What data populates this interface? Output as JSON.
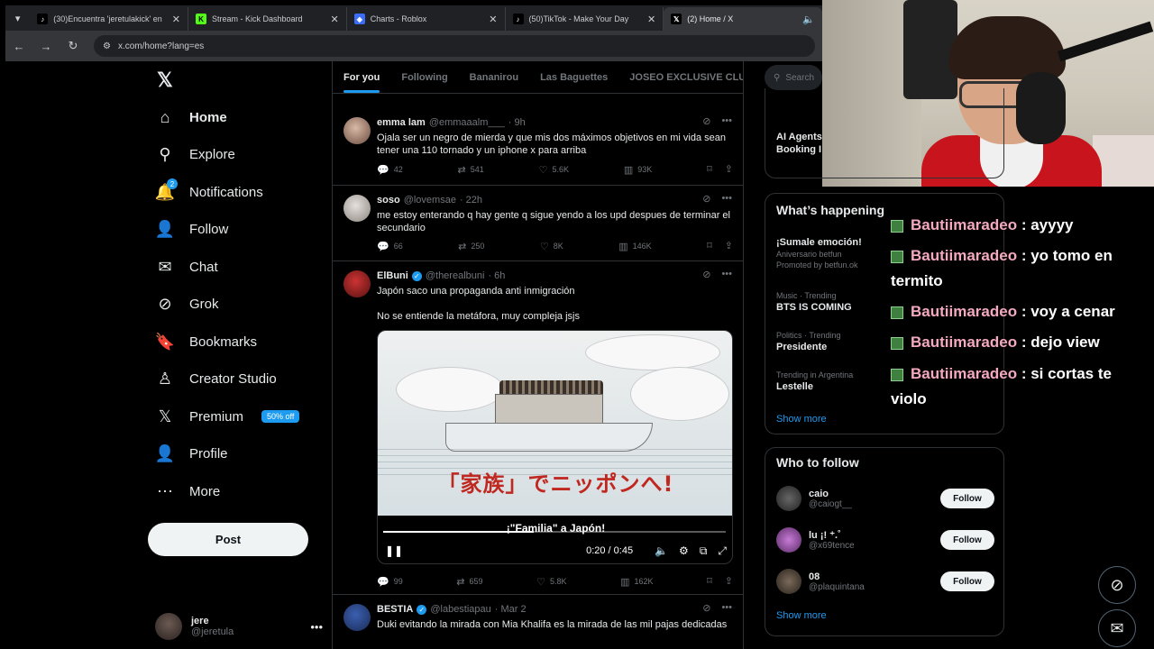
{
  "browser": {
    "tabs": [
      {
        "title": "(30)Encuentra 'jeretulakick' en",
        "color": "#000000",
        "icon": "tiktok-icon",
        "glyph": "♪"
      },
      {
        "title": "Stream - Kick Dashboard",
        "color": "#53fc18",
        "icon": "kick-icon",
        "glyph": "K"
      },
      {
        "title": "Charts - Roblox",
        "color": "#3b6cf6",
        "icon": "roblox-icon",
        "glyph": "◈"
      },
      {
        "title": "(50)TikTok - Make Your Day",
        "color": "#000000",
        "icon": "tiktok-icon",
        "glyph": "♪"
      },
      {
        "title": "(2) Home / X",
        "color": "#000000",
        "icon": "x-icon",
        "glyph": "𝕏"
      }
    ],
    "url": "x.com/home?lang=es"
  },
  "sidebar": {
    "items": [
      {
        "label": "Home",
        "icon": "home-icon",
        "glyph": "⌂",
        "bold": true
      },
      {
        "label": "Explore",
        "icon": "search-icon",
        "glyph": "⚲"
      },
      {
        "label": "Notifications",
        "icon": "bell-icon",
        "glyph": "🔔",
        "badge": "2"
      },
      {
        "label": "Follow",
        "icon": "follow-icon",
        "glyph": "👤"
      },
      {
        "label": "Chat",
        "icon": "mail-icon",
        "glyph": "✉"
      },
      {
        "label": "Grok",
        "icon": "grok-icon",
        "glyph": "⊘"
      },
      {
        "label": "Bookmarks",
        "icon": "bookmark-icon",
        "glyph": "🔖"
      },
      {
        "label": "Creator Studio",
        "icon": "creator-studio-icon",
        "glyph": "♙"
      },
      {
        "label": "Premium",
        "icon": "x-premium-icon",
        "glyph": "𝕏",
        "badge_text": "50% off"
      },
      {
        "label": "Profile",
        "icon": "profile-icon",
        "glyph": "👤"
      },
      {
        "label": "More",
        "icon": "more-circle-icon",
        "glyph": "⋯"
      }
    ],
    "post_label": "Post",
    "me": {
      "name": "jere",
      "handle": "@jeretula"
    }
  },
  "feed": {
    "tabs": [
      "For you",
      "Following",
      "Bananirou",
      "Las Baguettes",
      "JOSEO EXCLUSIVE CLU"
    ],
    "tweets": [
      {
        "name": "emma lam",
        "handle": "@emmaaalm___",
        "time": "· 9h",
        "text": "Ojala ser un negro de mierda y que mis dos máximos objetivos en mi vida sean tener una 110 tornado y un iphone x para arriba",
        "replies": "42",
        "reposts": "541",
        "likes": "5.6K",
        "views": "93K"
      },
      {
        "name": "soso",
        "handle": "@lovemsae",
        "time": "· 22h",
        "text": "me estoy enterando q hay gente q sigue yendo a los upd despues de terminar el secundario",
        "replies": "66",
        "reposts": "250",
        "likes": "8K",
        "views": "146K"
      },
      {
        "name": "ElBuni",
        "handle": "@therealbuni",
        "time": "· 6h",
        "text": "Japón saco una propaganda anti inmigración",
        "text2": "No se entiende la metáfora, muy compleja jsjs",
        "replies": "99",
        "reposts": "659",
        "likes": "5.8K",
        "views": "162K",
        "video": {
          "caption_jp": "「家族」でニッポンへ!",
          "caption_es": "¡\"Familia\" a Japón!",
          "time": "0:20 / 0:45",
          "progress": 0.44
        }
      },
      {
        "name": "BESTIA",
        "handle": "@labestiapau",
        "time": "· Mar 2",
        "text": "Duki evitando la mirada con Mia Khalifa es la mirada de las mil pajas dedicadas"
      }
    ]
  },
  "right": {
    "search_placeholder": "Search",
    "promo_partial": {
      "title": "AI Agents",
      "sub": "Booking I"
    },
    "whats_happening": {
      "title": "What’s happening",
      "trends": [
        {
          "meta": "",
          "name": "¡Sumale emoción!",
          "sub": "Aniversario betfun",
          "sub2": "Promoted by betfun.ok"
        },
        {
          "meta": "Music · Trending",
          "name": "BTS IS COMING"
        },
        {
          "meta": "Politics · Trending",
          "name": "Presidente"
        },
        {
          "meta": "Trending in Argentina",
          "name": "Lestelle"
        }
      ],
      "show_more": "Show more"
    },
    "who_to_follow": {
      "title": "Who to follow",
      "users": [
        {
          "name": "caio",
          "handle": "@caiogt__",
          "button": "Follow"
        },
        {
          "name": "lu ¡! ⁺.˚",
          "handle": "@x69tence",
          "button": "Follow"
        },
        {
          "name": "08",
          "handle": "@plaquintana",
          "button": "Follow"
        }
      ],
      "show_more": "Show more"
    }
  },
  "chat": [
    {
      "user": "Bautiimaradeo",
      "msg": " : ayyyy"
    },
    {
      "user": "Bautiimaradeo",
      "msg": " : yo tomo en termito"
    },
    {
      "user": "Bautiimaradeo",
      "msg": " : voy a cenar"
    },
    {
      "user": "Bautiimaradeo",
      "msg": " : dejo view"
    },
    {
      "user": "Bautiimaradeo",
      "msg": " : si cortas te violo"
    }
  ],
  "colors": {
    "accent": "#1d9bf0",
    "background": "#000000",
    "border": "#2f3336",
    "muted": "#71767b"
  }
}
